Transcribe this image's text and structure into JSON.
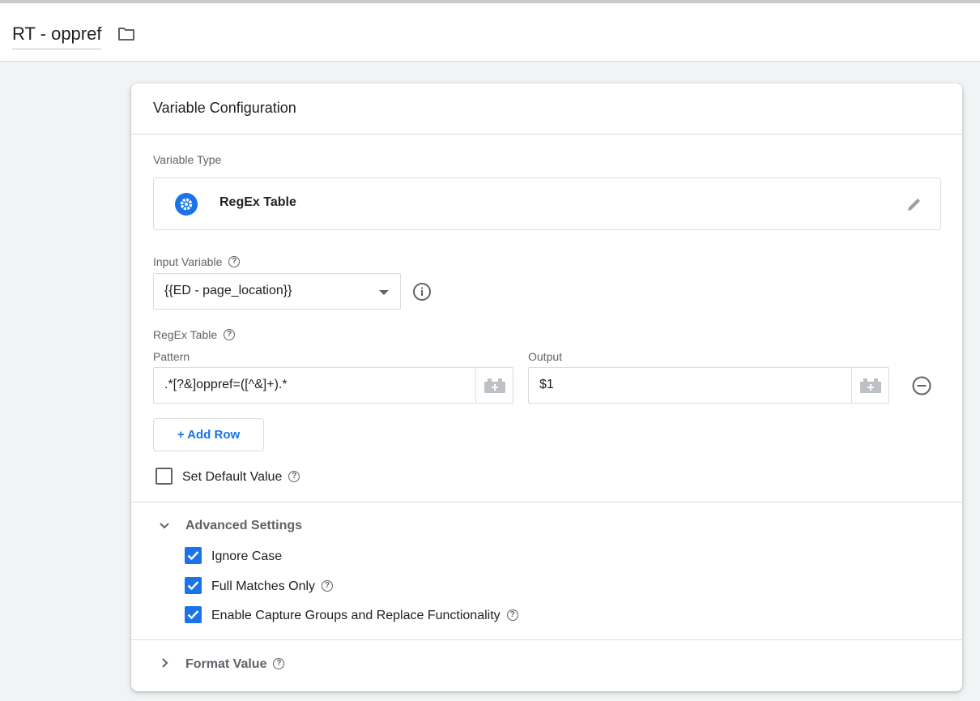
{
  "header": {
    "title": "RT - oppref"
  },
  "card": {
    "heading": "Variable Configuration"
  },
  "variable_type": {
    "label": "Variable Type",
    "name": "RegEx Table"
  },
  "input_variable": {
    "label": "Input Variable",
    "value": "{{ED - page_location}}"
  },
  "regex_table": {
    "label": "RegEx Table",
    "pattern_label": "Pattern",
    "output_label": "Output",
    "rows": [
      {
        "pattern": ".*[?&]oppref=([^&]+).*",
        "output": "$1"
      }
    ],
    "add_row_label": "+ Add Row"
  },
  "default_value": {
    "label": "Set Default Value",
    "checked": false
  },
  "advanced": {
    "title": "Advanced Settings",
    "options": [
      {
        "label": "Ignore Case",
        "checked": true
      },
      {
        "label": "Full Matches Only",
        "checked": true
      },
      {
        "label": "Enable Capture Groups and Replace Functionality",
        "checked": true
      }
    ]
  },
  "format_value": {
    "title": "Format Value"
  },
  "colors": {
    "accent": "#1a73e8",
    "border": "#dadce0",
    "muted": "#5f6368"
  }
}
